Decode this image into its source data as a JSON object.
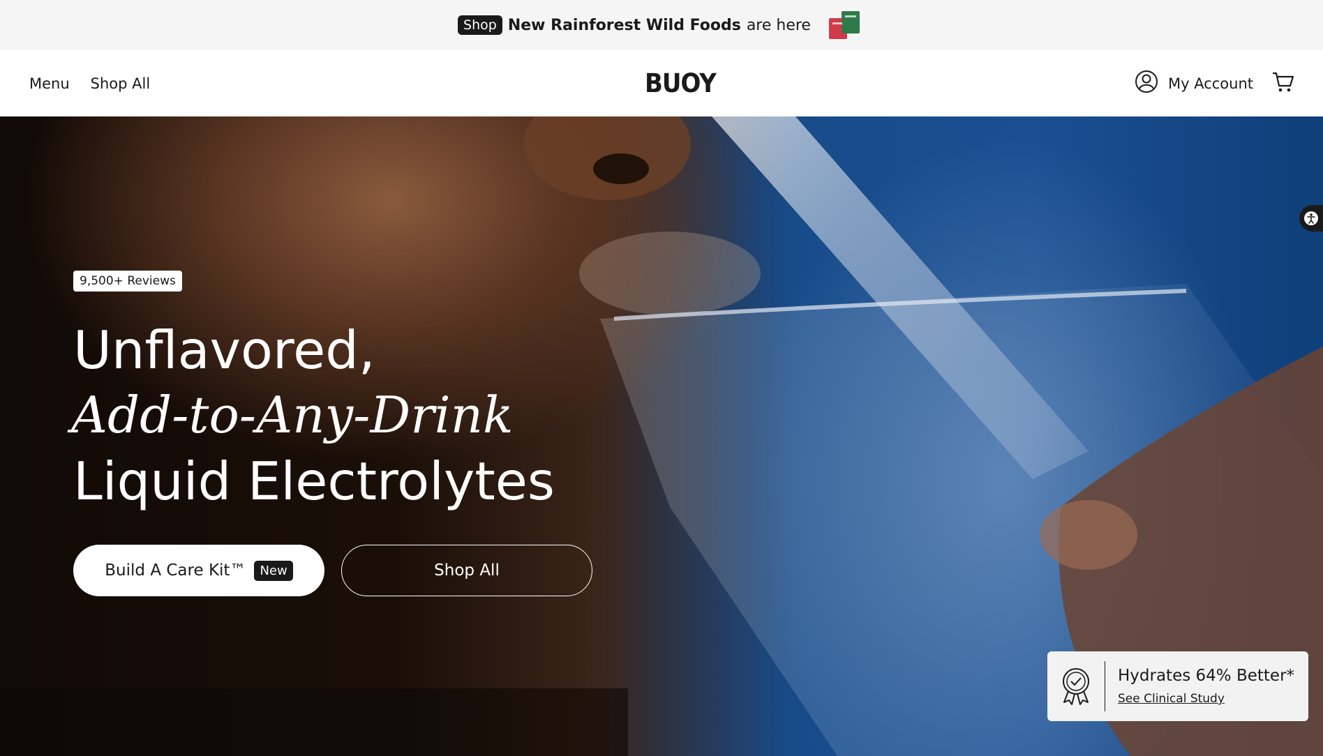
{
  "announcement": {
    "badge": "Shop",
    "highlight": "New Rainforest Wild Foods",
    "rest": "are here"
  },
  "header": {
    "menu_label": "Menu",
    "shop_all_label": "Shop All",
    "logo": "BUOY",
    "account_label": "My Account",
    "cart_icon": "cart-icon",
    "account_icon": "user-circle-icon"
  },
  "hero": {
    "reviews_badge": "9,500+ Reviews",
    "headline_line1": "Unflavored,",
    "headline_line2": "Add-to-Any-Drink",
    "headline_line3": "Liquid Electrolytes",
    "primary_button_label": "Build A Care Kit™",
    "primary_button_tag": "New",
    "secondary_button_label": "Shop All"
  },
  "claim": {
    "title": "Hydrates 64% Better*",
    "link": "See Clinical Study",
    "icon": "award-ribbon-icon"
  },
  "accessibility": {
    "icon": "accessibility-icon"
  },
  "colors": {
    "dark": "#1a1a1a",
    "announcement_bg": "#f5f5f5",
    "hero_blue": "#1b4f92"
  }
}
